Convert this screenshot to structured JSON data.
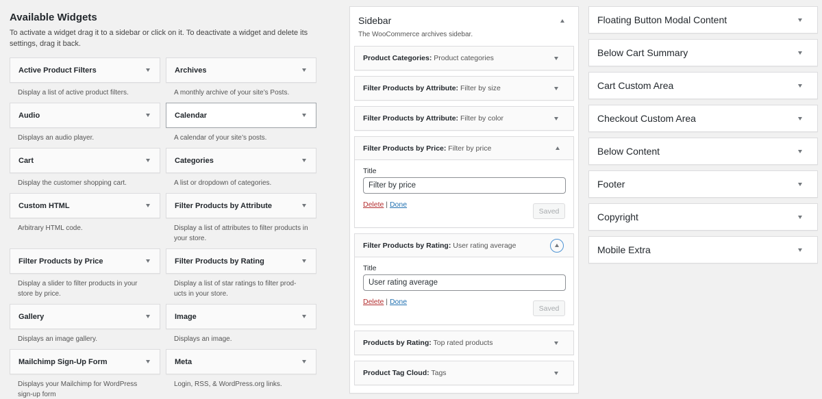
{
  "available": {
    "heading": "Available Widgets",
    "intro": "To activate a widget drag it to a sidebar or click on it. To deactivate a widget and delete its settings, drag it back.",
    "widgets": [
      {
        "title": "Active Product Filters",
        "desc": "Display a list of active product filters."
      },
      {
        "title": "Archives",
        "desc": "A monthly archive of your site’s Posts."
      },
      {
        "title": "Audio",
        "desc": "Displays an audio player."
      },
      {
        "title": "Calendar",
        "desc": "A calendar of your site’s posts."
      },
      {
        "title": "Cart",
        "desc": "Display the customer shopping cart."
      },
      {
        "title": "Categories",
        "desc": "A list or dropdown of categories."
      },
      {
        "title": "Custom HTML",
        "desc": "Arbitrary HTML code."
      },
      {
        "title": "Filter Products by Attribute",
        "desc": "Display a list of attributes to filter products in your store."
      },
      {
        "title": "Filter Products by Price",
        "desc": "Display a slider to filter products in your store by price."
      },
      {
        "title": "Filter Products by Rating",
        "desc": "Display a list of star ratings to filter prod-ucts in your store."
      },
      {
        "title": "Gallery",
        "desc": "Displays an image gallery."
      },
      {
        "title": "Image",
        "desc": "Displays an image."
      },
      {
        "title": "Mailchimp Sign-Up Form",
        "desc": "Displays your Mailchimp for WordPress sign-up form"
      },
      {
        "title": "Meta",
        "desc": "Login, RSS, & WordPress.org links."
      }
    ]
  },
  "sidebar": {
    "title": "Sidebar",
    "description": "The WooCommerce archives sidebar.",
    "widgets": [
      {
        "name": "Product Categories:",
        "instance": "Product categories"
      },
      {
        "name": "Filter Products by Attribute:",
        "instance": "Filter by size"
      },
      {
        "name": "Filter Products by Attribute:",
        "instance": "Filter by color"
      },
      {
        "name": "Filter Products by Price:",
        "instance": "Filter by price",
        "field_label": "Title",
        "field_value": "Filter by price"
      },
      {
        "name": "Filter Products by Rating:",
        "instance": "User rating average",
        "field_label": "Title",
        "field_value": "User rating average"
      },
      {
        "name": "Products by Rating:",
        "instance": "Top rated products"
      },
      {
        "name": "Product Tag Cloud:",
        "instance": "Tags"
      }
    ],
    "delete_label": "Delete",
    "separator": "|",
    "done_label": "Done",
    "saved_label": "Saved"
  },
  "areas": [
    {
      "title": "Floating Button Modal Content"
    },
    {
      "title": "Below Cart Summary"
    },
    {
      "title": "Cart Custom Area"
    },
    {
      "title": "Checkout Custom Area"
    },
    {
      "title": "Below Content"
    },
    {
      "title": "Footer"
    },
    {
      "title": "Copyright"
    },
    {
      "title": "Mobile Extra"
    }
  ]
}
